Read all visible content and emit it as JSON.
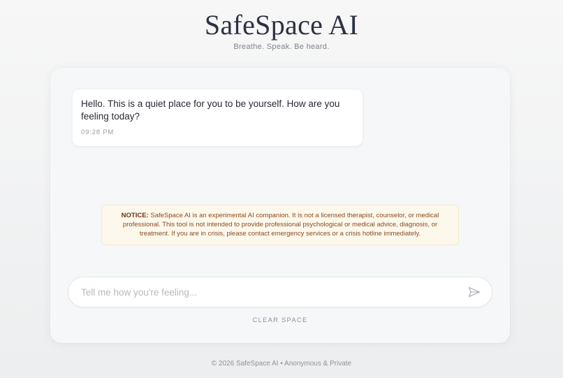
{
  "header": {
    "title": "SafeSpace AI",
    "tagline": "Breathe. Speak. Be heard."
  },
  "chat": {
    "messages": [
      {
        "sender": "assistant",
        "text": "Hello. This is a quiet place for you to be yourself. How are you feeling today?",
        "time": "09:28 PM"
      }
    ]
  },
  "notice": {
    "label": "NOTICE:",
    "text": " SafeSpace AI is an experimental AI companion. It is not a licensed therapist, counselor, or medical professional. This tool is not intended to provide professional psychological or medical advice, diagnosis, or treatment. If you are in crisis, please contact emergency services or a crisis hotline immediately."
  },
  "composer": {
    "placeholder": "Tell me how you're feeling...",
    "value": "",
    "send_icon": "send-icon"
  },
  "actions": {
    "clear_label": "CLEAR SPACE"
  },
  "footer": {
    "text": "© 2026 SafeSpace AI • Anonymous & Private"
  },
  "colors": {
    "title": "#2c3142",
    "notice_bg": "#fdf8ec",
    "notice_text": "#8a4b1e",
    "muted": "#8e939b"
  }
}
